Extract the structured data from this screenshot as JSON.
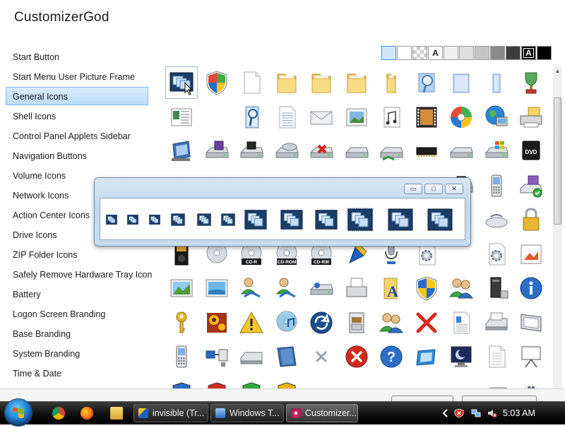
{
  "app": {
    "title": "CustomizerGod"
  },
  "categories": [
    "Start Button",
    "Start Menu User Picture Frame",
    "General Icons",
    "Shell Icons",
    "Control Panel Applets Sidebar",
    "Navigation Buttons",
    "Volume Icons",
    "Network Icons",
    "Action Center Icons",
    "Drive Icons",
    "ZIP Folder Icons",
    "Safely Remove Hardware Tray Icon",
    "Battery",
    "Logon Screen Branding",
    "Base Branding",
    "System Branding",
    "Time & Date"
  ],
  "selected_category_index": 2,
  "swatches": [
    {
      "color": "#cfe6fb",
      "label": ""
    },
    {
      "color": "#ffffff",
      "label": ""
    },
    {
      "color": "checker",
      "label": ""
    },
    {
      "color": "#ffffff",
      "label": "A"
    },
    {
      "color": "#f0f0f0",
      "label": ""
    },
    {
      "color": "#dedede",
      "label": ""
    },
    {
      "color": "#c4c4c4",
      "label": ""
    },
    {
      "color": "#8a8a8a",
      "label": ""
    },
    {
      "color": "#3c3c3c",
      "label": ""
    },
    {
      "color": "#000000",
      "label": "A"
    },
    {
      "color": "#000000",
      "label": ""
    }
  ],
  "grid_icons": [
    [
      "window-frames-icon",
      "shield-icon",
      "blank-document-icon",
      "folder-tall-icon",
      "folder-icon",
      "folder-icon",
      "folder-narrow-icon",
      "search-folder-icon",
      "folder-blue-icon",
      "folder-blue-narrow-icon",
      "trophy-icon"
    ],
    [
      "window-list-icon",
      "blank",
      "search-document-icon",
      "text-document-icon",
      "envelope-icon",
      "picture-frame-icon",
      "music-document-icon",
      "film-icon",
      "color-wheel-icon",
      "globe-computer-icon",
      "printer-folder-icon"
    ],
    [
      "pda-icon",
      "floppy-drive-icon",
      "drive-dark-icon",
      "cd-drive-icon",
      "drive-error-icon",
      "drive-icon",
      "network-drive-icon",
      "memory-chip-icon",
      "drive-flat-icon",
      "windows-drive-icon",
      "dvd-drive-icon"
    ],
    [
      "drive-round-icon",
      "drive-round-icon",
      "drive-round-icon",
      "drive-round-icon",
      "drive-round-icon",
      "drive-round-icon",
      "drive-round-icon",
      "globe-small-icon",
      "drive-dark-icon",
      "phone-icon",
      "floppy-check-icon"
    ],
    [
      "blank",
      "blank",
      "blank",
      "blank",
      "blank",
      "blank",
      "blank",
      "blank",
      "blank",
      "mouse-icon",
      "padlock-icon"
    ],
    [
      "media-player-icon",
      "cd-disc-icon",
      "cd-r-icon",
      "cd-rom-icon",
      "cd-rw-icon",
      "pen-tool-icon",
      "microphone-icon",
      "gear-document-icon",
      "blank",
      "gear-document-icon",
      "paint-icon"
    ],
    [
      "image-landscape-icon",
      "image-sea-icon",
      "network-user-icon",
      "network-share-icon",
      "removable-drive-icon",
      "fax-icon",
      "font-icon",
      "uac-shield-icon",
      "users-icon",
      "tower-computer-icon",
      "info-icon"
    ],
    [
      "key-icon",
      "sunflower-icon",
      "warning-icon",
      "dvd-music-icon",
      "sync-icon",
      "file-cabinet-icon",
      "two-users-icon",
      "red-x-icon",
      "document-edit-icon",
      "scanner-icon",
      "screen-panel-icon"
    ],
    [
      "handheld-icon",
      "network-bridge-icon",
      "scanner-flat-icon",
      "book-icon",
      "small-x-icon",
      "error-circle-icon",
      "help-circle-icon",
      "blue-window-icon",
      "monitor-moon-icon",
      "text-page-icon",
      "projector-icon"
    ],
    [
      "shield-small-icon",
      "shield-red-icon",
      "shield-green-icon",
      "shield-yellow-icon",
      "blank",
      "blank",
      "blank",
      "mosaic-icon",
      "blank",
      "drive-icon",
      "gear-icon"
    ]
  ],
  "disc_labels": {
    "cd_r": "CD-R",
    "cd_rom": "CD-ROM",
    "cd_rw": "CD-RW",
    "dvd": "DVD"
  },
  "preview_window": {
    "caption_buttons": [
      "minimize-button",
      "maximize-button",
      "close-button"
    ],
    "caption_glyphs": {
      "minimize": "▭",
      "maximize": "□",
      "close": "✕"
    }
  },
  "taskbar": {
    "quick_launch": [
      "chrome-icon",
      "firefox-icon",
      "explorer-folder-icon"
    ],
    "tasks": [
      {
        "label": "invisible (Tr...",
        "icon": "pen-tool-icon",
        "active": false
      },
      {
        "label": "Windows T...",
        "icon": "windows-task-icon",
        "active": false
      },
      {
        "label": "Customizer...",
        "icon": "gear-flower-icon",
        "active": true
      }
    ],
    "clock": "5:03 AM",
    "tray_icons": [
      "chevron-left-icon",
      "security-alert-icon",
      "network-icon",
      "volume-muted-icon"
    ]
  }
}
